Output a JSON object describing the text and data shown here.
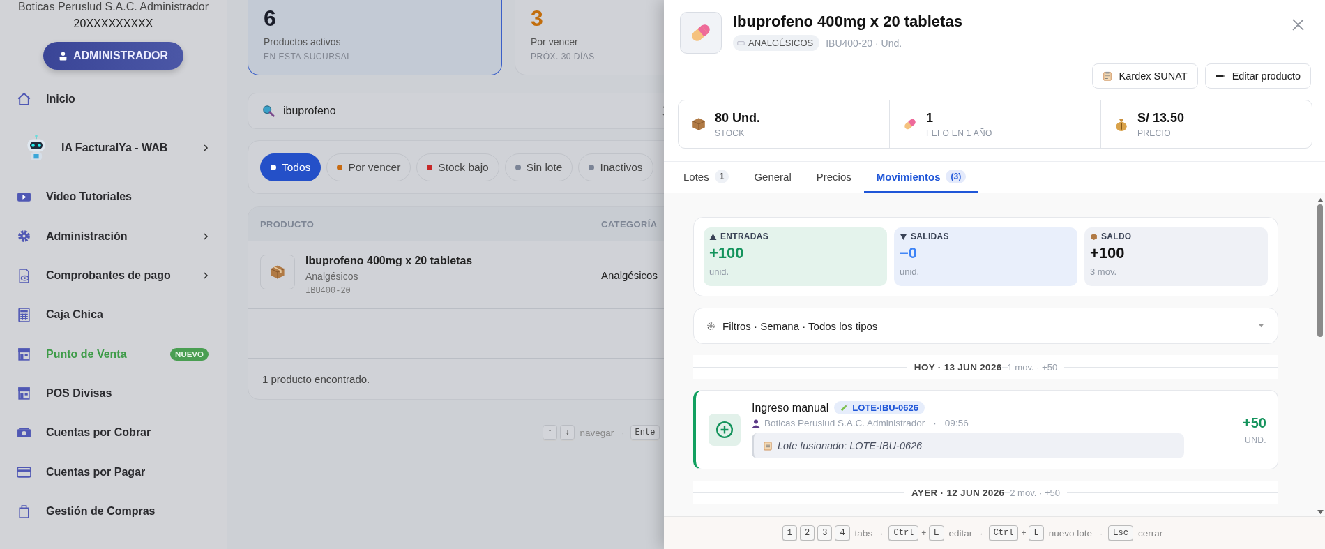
{
  "sidebar": {
    "company": "Boticas Peruslud S.A.C. Administrador",
    "ruc": "20XXXXXXXXX",
    "role_button": "ADMINISTRADOR",
    "items": [
      {
        "label": "Inicio",
        "highlighted": false,
        "submenu": false
      },
      {
        "label": "IA FacturalYa - WAB",
        "highlighted": false,
        "submenu": true
      },
      {
        "label": "Video Tutoriales",
        "highlighted": false,
        "submenu": false
      },
      {
        "label": "Administración",
        "highlighted": false,
        "submenu": true
      },
      {
        "label": "Comprobantes de pago",
        "highlighted": false,
        "submenu": true
      },
      {
        "label": "Caja Chica",
        "highlighted": false,
        "submenu": false
      },
      {
        "label": "Punto de Venta",
        "highlighted": true,
        "submenu": false,
        "badge": "NUEVO"
      },
      {
        "label": "POS Divisas",
        "highlighted": false,
        "submenu": false
      },
      {
        "label": "Cuentas por Cobrar",
        "highlighted": false,
        "submenu": false
      },
      {
        "label": "Cuentas por Pagar",
        "highlighted": false,
        "submenu": false
      },
      {
        "label": "Gestión de Compras",
        "highlighted": false,
        "submenu": false
      }
    ]
  },
  "stats": [
    {
      "value": "6",
      "label": "Productos activos",
      "sublabel": "EN ESTA SUCURSAL",
      "selected": true,
      "color": "#1a1d29"
    },
    {
      "value": "3",
      "label": "Por vencer",
      "sublabel": "PRÓX. 30 DÍAS",
      "selected": false,
      "color": "#c26d0c"
    }
  ],
  "search": {
    "value": "ibuprofeno"
  },
  "filters": [
    {
      "label": "Todos",
      "selected": true,
      "color": "#ffffff"
    },
    {
      "label": "Por vencer",
      "selected": false,
      "color": "#c76b12"
    },
    {
      "label": "Stock bajo",
      "selected": false,
      "color": "#c62828"
    },
    {
      "label": "Sin lote",
      "selected": false,
      "color": "#7b8496"
    },
    {
      "label": "Inactivos",
      "selected": false,
      "color": "#7b8496"
    }
  ],
  "table": {
    "columns": [
      "PRODUCTO",
      "CATEGORÍA"
    ],
    "rows": [
      {
        "name": "Ibuprofeno 400mg x 20 tabletas",
        "subtitle": "Analgésicos",
        "code": "IBU400-20",
        "category": "Analgésicos"
      }
    ],
    "footer": "1 producto encontrado."
  },
  "hints": [
    {
      "kind": "key",
      "text": "↑"
    },
    {
      "kind": "key",
      "text": "↓"
    },
    {
      "kind": "label",
      "text": "navegar"
    },
    {
      "kind": "sep",
      "text": "·"
    },
    {
      "kind": "key",
      "text": "Ente"
    }
  ],
  "drawer": {
    "title": "Ibuprofeno 400mg x 20 tabletas",
    "tag": "ANALGÉSICOS",
    "meta": "IBU400-20 · Und.",
    "actions": [
      {
        "label": "Kardex SUNAT"
      },
      {
        "label": "Editar producto"
      }
    ],
    "stats": [
      {
        "value": "80 Und.",
        "label": "STOCK"
      },
      {
        "value": "1",
        "label": "FEFO EN 1 AÑO"
      },
      {
        "value": "S/ 13.50",
        "label": "PRECIO"
      }
    ],
    "tabs": [
      {
        "label": "Lotes",
        "count": "1",
        "selected": false
      },
      {
        "label": "General",
        "selected": false
      },
      {
        "label": "Precios",
        "selected": false
      },
      {
        "label": "Movimientos",
        "count": "(3)",
        "selected": true
      }
    ],
    "summary": [
      {
        "kind": "in",
        "label": "ENTRADAS",
        "value": "+100",
        "note": "unid."
      },
      {
        "kind": "out",
        "label": "SALIDAS",
        "value": "−0",
        "note": "unid."
      },
      {
        "kind": "balance",
        "label": "SALDO",
        "value": "+100",
        "note": "3 mov."
      }
    ],
    "filter_bar": "Filtros · Semana · Todos los tipos",
    "days": [
      {
        "label": "HOY · 13 JUN 2026",
        "meta": "1 mov. · +50",
        "movements": [
          {
            "kind": "in",
            "title": "Ingreso manual",
            "lot": "LOTE-IBU-0626",
            "user": "Boticas Peruslud S.A.C. Administrador",
            "sep": "·",
            "time": "09:56",
            "note": "Lote fusionado: LOTE-IBU-0626",
            "amount": "+50",
            "unit": "UND."
          }
        ]
      },
      {
        "label": "AYER · 12 JUN 2026",
        "meta": "2 mov. · +50"
      }
    ],
    "shortcuts": [
      {
        "kind": "key",
        "text": "1"
      },
      {
        "kind": "key",
        "text": "2"
      },
      {
        "kind": "key",
        "text": "3"
      },
      {
        "kind": "key",
        "text": "4"
      },
      {
        "kind": "label",
        "text": "tabs"
      },
      {
        "kind": "sep",
        "text": "·"
      },
      {
        "kind": "key",
        "text": "Ctrl"
      },
      {
        "kind": "plus",
        "text": "+"
      },
      {
        "kind": "key",
        "text": "E"
      },
      {
        "kind": "label",
        "text": "editar"
      },
      {
        "kind": "sep",
        "text": "·"
      },
      {
        "kind": "key",
        "text": "Ctrl"
      },
      {
        "kind": "plus",
        "text": "+"
      },
      {
        "kind": "key",
        "text": "L"
      },
      {
        "kind": "label",
        "text": "nuevo lote"
      },
      {
        "kind": "sep",
        "text": "·"
      },
      {
        "kind": "key",
        "text": "Esc"
      },
      {
        "kind": "label",
        "text": "cerrar"
      }
    ]
  }
}
